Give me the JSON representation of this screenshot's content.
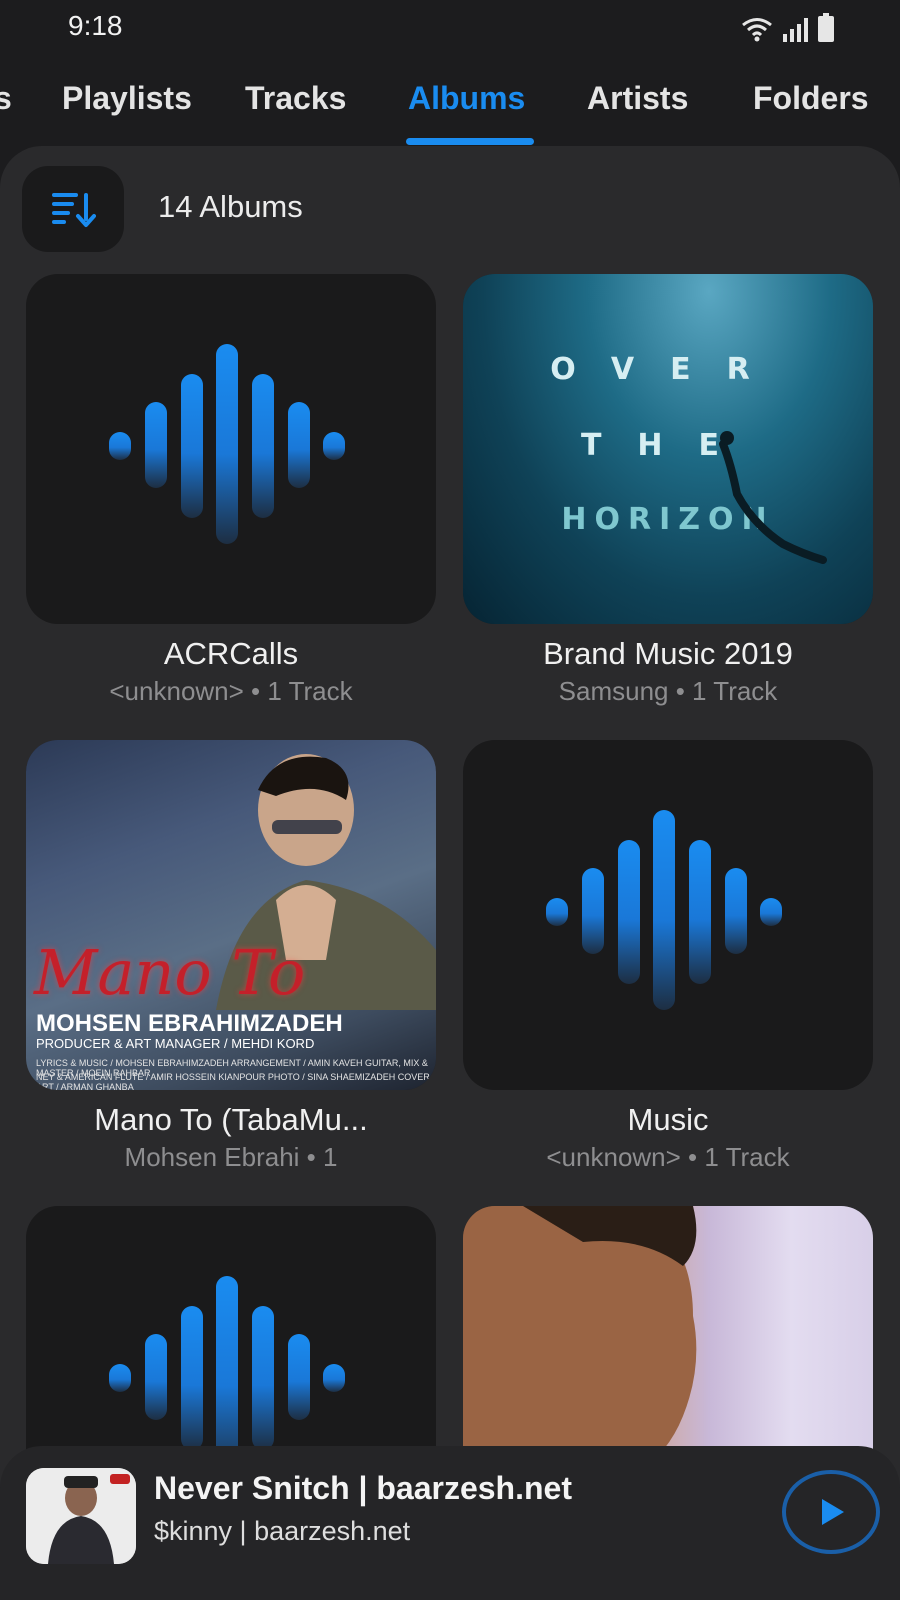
{
  "status_bar": {
    "time": "9:18"
  },
  "tabs": [
    {
      "label": "s"
    },
    {
      "label": "Playlists"
    },
    {
      "label": "Tracks"
    },
    {
      "label": "Albums"
    },
    {
      "label": "Artists"
    },
    {
      "label": "Folders"
    }
  ],
  "active_tab": "Albums",
  "header": {
    "album_count": "14 Albums"
  },
  "albums": [
    {
      "title": "ACRCalls",
      "subtitle": "<unknown> • 1 Track",
      "art": "waveform-placeholder"
    },
    {
      "title": "Brand Music 2019",
      "subtitle": "Samsung • 1 Track",
      "art": "ocean-diver",
      "art_text": {
        "line1": "OVER",
        "line2": "THE",
        "line3": "HORIZON"
      }
    },
    {
      "title": "Mano To (TabaMu...",
      "subtitle": "Mohsen Ebrahi • 1",
      "art": "portrait-cover",
      "art_text": {
        "title": "Mano To",
        "name": "MOHSEN EBRAHIMZADEH",
        "role": "PRODUCER & ART MANAGER / MEHDI KORD",
        "credit1": "LYRICS & MUSIC / MOHSEN EBRAHIMZADEH   ARRANGEMENT / AMIN KAVEH   GUITAR, MIX & MASTER / MOEIN RAHBAR",
        "credit2": "NEY & AMERICAN FLUTE / AMIR HOSSEIN KIANPOUR   PHOTO / SINA SHAEMIZADEH   COVER ART / ARMAN GHANBA"
      }
    },
    {
      "title": "Music",
      "subtitle": "<unknown> • 1 Track",
      "art": "waveform-placeholder"
    },
    {
      "title": "",
      "subtitle": "",
      "art": "waveform-placeholder"
    },
    {
      "title": "",
      "subtitle": "",
      "art": "man-profile-photo"
    }
  ],
  "mini_player": {
    "title": "Never Snitch | baarzesh.net",
    "artist": "$kinny | baarzesh.net"
  },
  "colors": {
    "accent": "#1a8cf0",
    "background": "#1c1c1e",
    "panel": "#2a2a2c",
    "subtitle": "#8e8e90"
  },
  "icons": {
    "sort": "sort-descending-icon",
    "play": "play-icon",
    "wifi": "wifi-icon",
    "signal": "signal-icon",
    "battery": "battery-icon"
  }
}
